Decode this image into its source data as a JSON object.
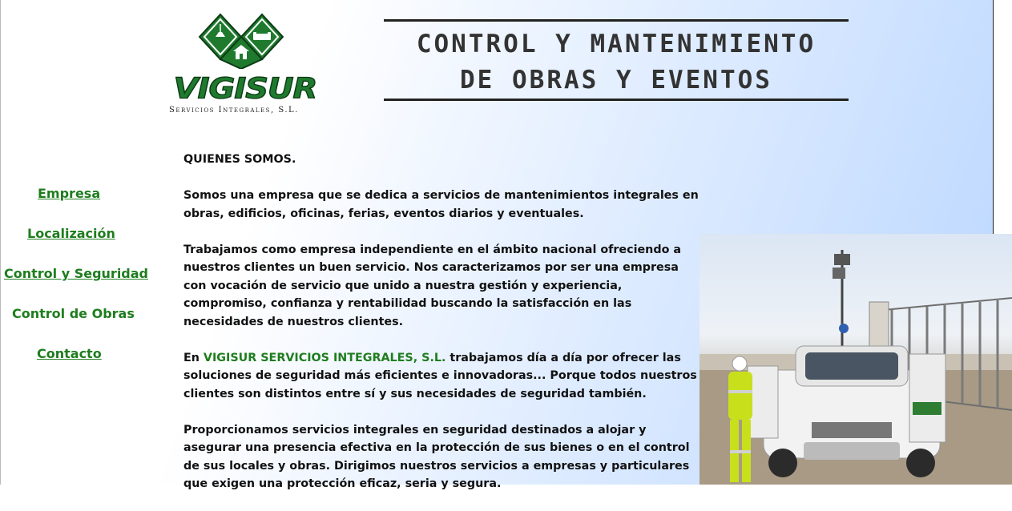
{
  "brand": {
    "name": "VIGISUR",
    "subtitle": "Servicios Integrales, S.L."
  },
  "header": {
    "title_line1": "CONTROL Y MANTENIMIENTO",
    "title_line2": "DE OBRAS Y EVENTOS"
  },
  "nav": {
    "items": [
      {
        "label": "Empresa"
      },
      {
        "label": "Localización"
      },
      {
        "label": "Control y Seguridad"
      },
      {
        "label": "Control de Obras"
      },
      {
        "label": "Contacto"
      }
    ]
  },
  "content": {
    "heading": "QUIENES SOMOS.",
    "p1": "Somos una empresa que se dedica a servicios de mantenimientos integrales en obras, edificios, oficinas, ferias, eventos diarios y eventuales.",
    "p2": "Trabajamos como empresa independiente en el ámbito nacional ofreciendo a nuestros clientes un buen servicio. Nos caracterizamos por ser una empresa con vocación de servicio que unido a nuestra gestión y experiencia, compromiso, confianza y rentabilidad buscando la satisfacción en las necesidades de nuestros clientes.",
    "p3_prefix": "En ",
    "p3_company": "VIGISUR SERVICIOS INTEGRALES, S.L.",
    "p3_rest": " trabajamos día a día por ofrecer las soluciones de seguridad más eficientes e innovadoras... Porque todos nuestros clientes son distintos entre sí y sus necesidades de seguridad también.",
    "p4": "Proporcionamos servicios integrales en seguridad destinados a alojar y asegurar una presencia efectiva en la protección de sus bienes o en el control de sus locales y obras. Dirigimos nuestros servicios a empresas y particulares que exigen una protección eficaz, seria y segura."
  },
  "colors": {
    "accent_green": "#1e7d1e",
    "logo_green": "#1f7a2e"
  },
  "photo": {
    "icon": "security-vehicle-photo"
  }
}
